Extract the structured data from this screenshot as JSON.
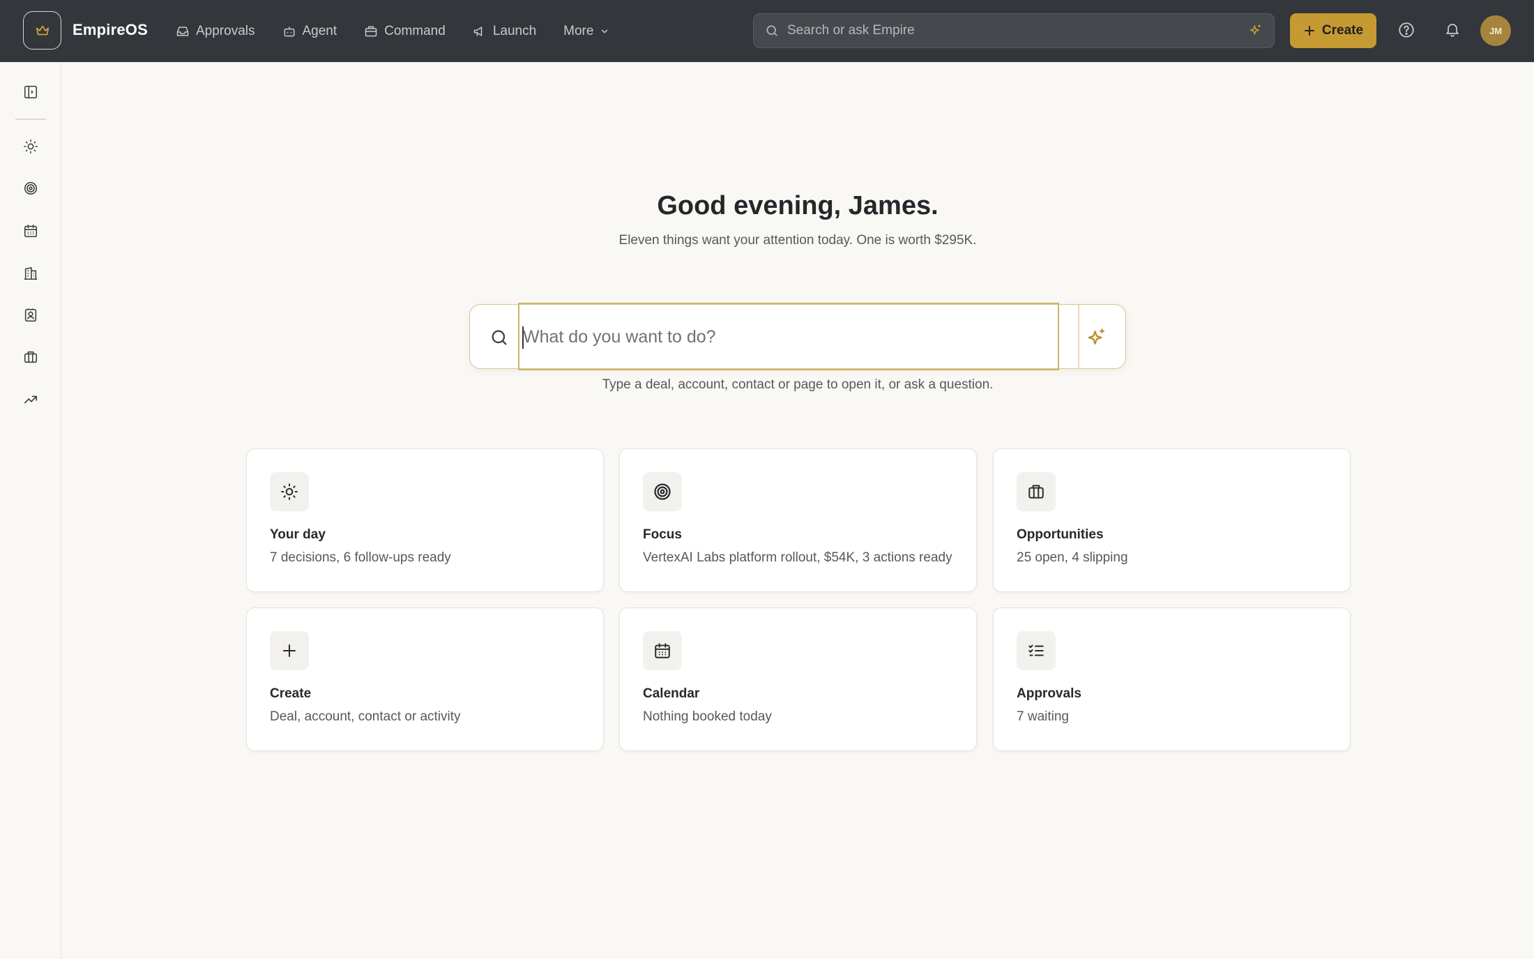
{
  "app": {
    "brand": "EmpireOS",
    "user_initials": "JM"
  },
  "nav": {
    "items": [
      {
        "label": "Approvals",
        "icon": "inbox-icon"
      },
      {
        "label": "Agent",
        "icon": "bot-icon"
      },
      {
        "label": "Command",
        "icon": "briefcase-icon"
      },
      {
        "label": "Launch",
        "icon": "megaphone-icon"
      },
      {
        "label": "More",
        "icon": "chevron-down-icon"
      }
    ]
  },
  "topbar": {
    "search_placeholder": "Search or ask Empire",
    "create_label": "Create"
  },
  "sidebar": {
    "items": [
      {
        "icon": "sidebar-toggle-icon"
      },
      {
        "icon": "sun-icon"
      },
      {
        "icon": "target-icon"
      },
      {
        "icon": "calendar-icon"
      },
      {
        "icon": "building-icon"
      },
      {
        "icon": "contact-card-icon"
      },
      {
        "icon": "briefcase-icon"
      },
      {
        "icon": "trending-up-icon"
      }
    ]
  },
  "main": {
    "greeting": "Good evening, James.",
    "subline": "Eleven things want your attention today. One is worth $295K.",
    "command_placeholder": "What do you want to do?",
    "hint": "Type a deal, account, contact or page to open it, or ask a question."
  },
  "cards": [
    {
      "title": "Your day",
      "desc": "7 decisions, 6 follow-ups ready",
      "icon": "sun-icon"
    },
    {
      "title": "Focus",
      "desc": "VertexAI Labs platform rollout, $54K, 3 actions ready",
      "icon": "target-icon"
    },
    {
      "title": "Opportunities",
      "desc": "25 open, 4 slipping",
      "icon": "briefcase-icon"
    },
    {
      "title": "Create",
      "desc": "Deal, account, contact or activity",
      "icon": "plus-icon"
    },
    {
      "title": "Calendar",
      "desc": "Nothing booked today",
      "icon": "calendar-icon"
    },
    {
      "title": "Approvals",
      "desc": "7 waiting",
      "icon": "checklist-icon"
    }
  ],
  "colors": {
    "topbar": "#33363a",
    "accent_gold": "#c59a32",
    "page_bg": "#f9f8f5"
  }
}
